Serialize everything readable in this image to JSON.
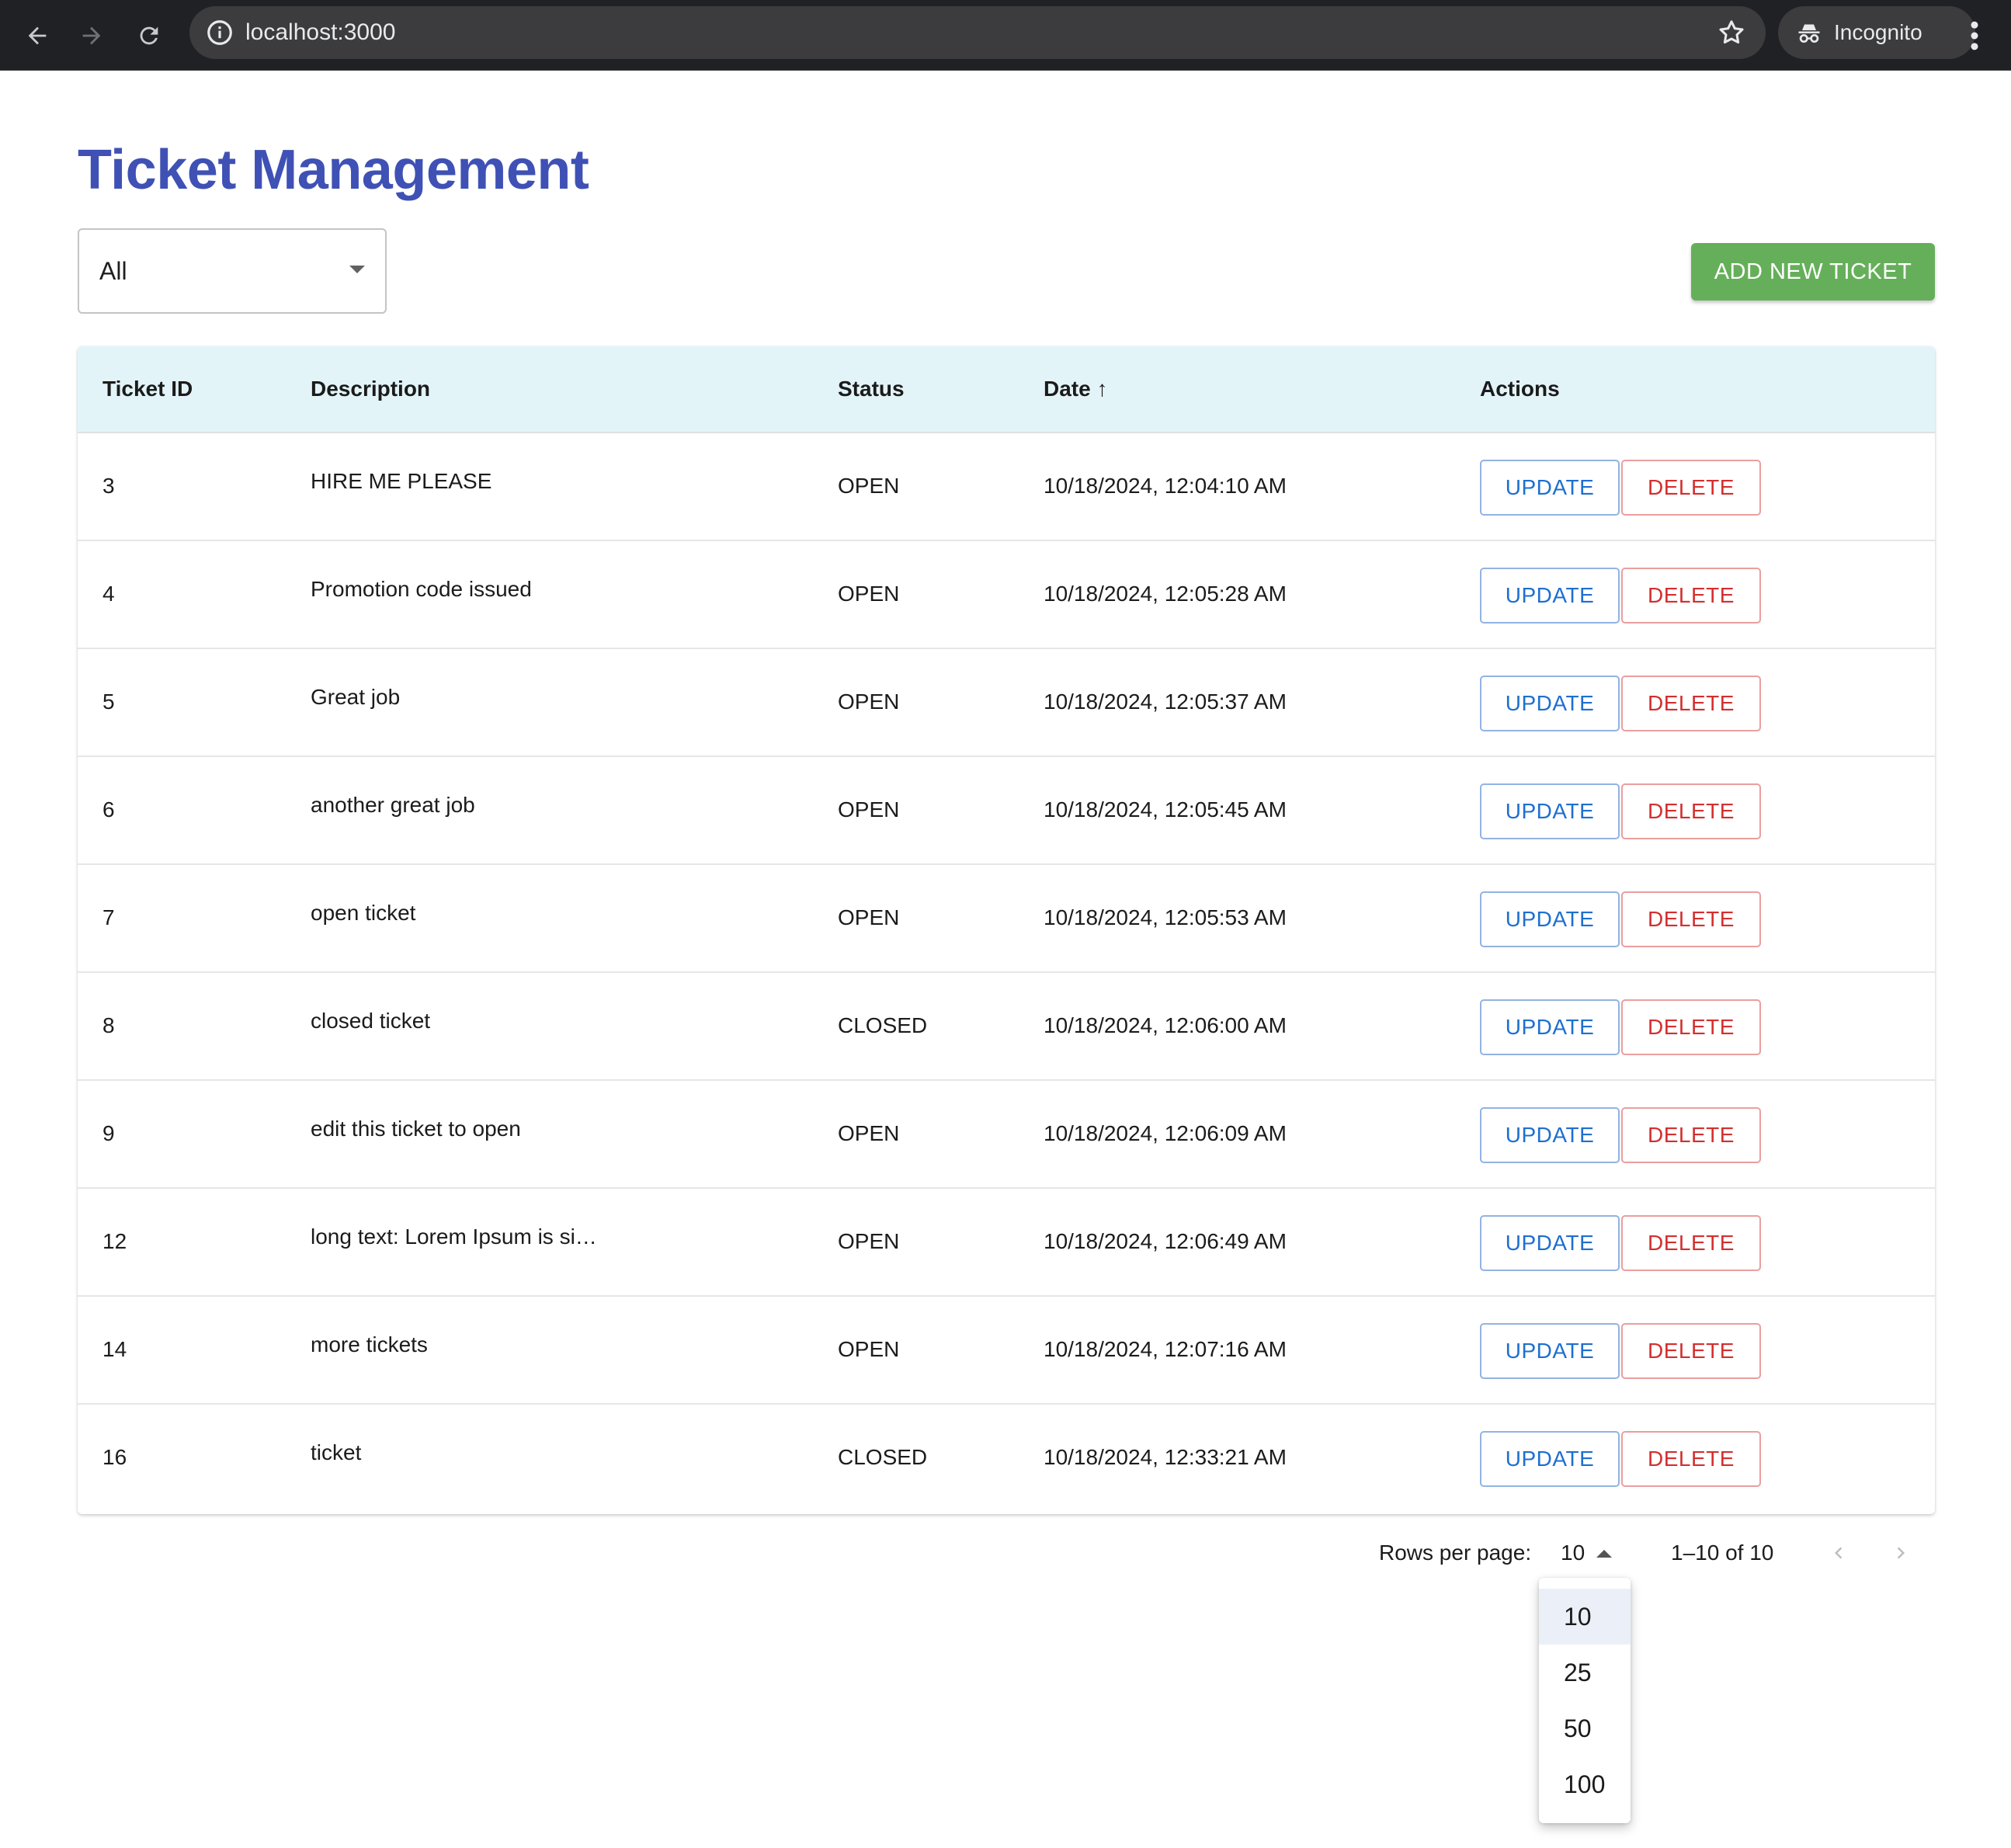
{
  "browser": {
    "url": "localhost:3000",
    "profile_label": "Incognito"
  },
  "page": {
    "title": "Ticket Management",
    "filter_value": "All",
    "add_button_label": "ADD NEW TICKET"
  },
  "table": {
    "headers": {
      "id": "Ticket ID",
      "description": "Description",
      "status": "Status",
      "date": "Date ↑",
      "actions": "Actions"
    },
    "action_labels": {
      "update": "UPDATE",
      "delete": "DELETE"
    },
    "rows": [
      {
        "id": "3",
        "description": "HIRE ME PLEASE",
        "status": "OPEN",
        "date": "10/18/2024, 12:04:10 AM"
      },
      {
        "id": "4",
        "description": "Promotion code issued",
        "status": "OPEN",
        "date": "10/18/2024, 12:05:28 AM"
      },
      {
        "id": "5",
        "description": "Great job",
        "status": "OPEN",
        "date": "10/18/2024, 12:05:37 AM"
      },
      {
        "id": "6",
        "description": "another great job",
        "status": "OPEN",
        "date": "10/18/2024, 12:05:45 AM"
      },
      {
        "id": "7",
        "description": "open ticket",
        "status": "OPEN",
        "date": "10/18/2024, 12:05:53 AM"
      },
      {
        "id": "8",
        "description": "closed ticket",
        "status": "CLOSED",
        "date": "10/18/2024, 12:06:00 AM"
      },
      {
        "id": "9",
        "description": "edit this ticket to open",
        "status": "OPEN",
        "date": "10/18/2024, 12:06:09 AM"
      },
      {
        "id": "12",
        "description": "long text: Lorem Ipsum is si…",
        "status": "OPEN",
        "date": "10/18/2024, 12:06:49 AM"
      },
      {
        "id": "14",
        "description": "more tickets",
        "status": "OPEN",
        "date": "10/18/2024, 12:07:16 AM"
      },
      {
        "id": "16",
        "description": "ticket",
        "status": "CLOSED",
        "date": "10/18/2024, 12:33:21 AM"
      }
    ]
  },
  "pagination": {
    "rows_per_page_label": "Rows per page:",
    "rows_per_page_value": "10",
    "range_text": "1–10 of 10",
    "options": [
      "10",
      "25",
      "50",
      "100"
    ],
    "selected_option": "10"
  },
  "colors": {
    "title": "#3f51b5",
    "add_button": "#66af5a",
    "table_header_bg": "#e3f4f9",
    "update": "#1e6fd0",
    "delete": "#d32f2f"
  }
}
